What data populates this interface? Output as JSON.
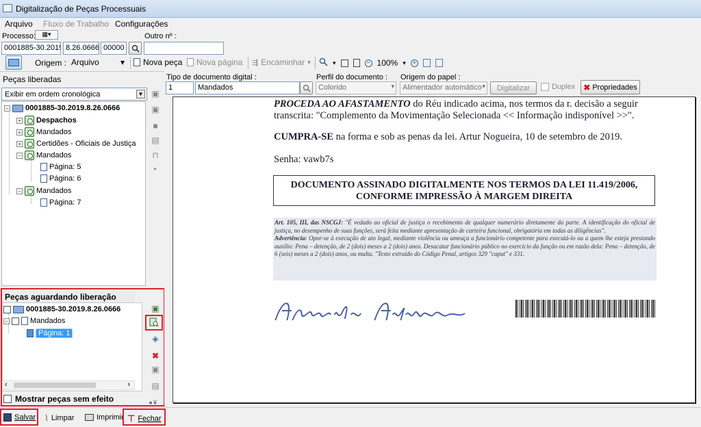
{
  "window": {
    "title": "Digitalização de Peças Processuais"
  },
  "menu": {
    "arquivo": "Arquivo",
    "fluxo": "Fluxo de Trabalho",
    "config": "Configurações"
  },
  "processo": {
    "label": "Processo:",
    "outro_label": "Outro nº :",
    "number_parts": [
      "0001885-30.2019",
      "8.26.0666",
      "00000"
    ],
    "outro_value": ""
  },
  "toolbar": {
    "origem_label": "Origem :",
    "origem_value": "Arquivo",
    "nova_peca": "Nova peça",
    "nova_pagina": "Nova página",
    "encaminhar": "Encaminhar",
    "zoom": "100%"
  },
  "doc_type": {
    "tipo_label": "Tipo de documento digital :",
    "tipo_code": "1",
    "tipo_value": "Mandados",
    "perfil_label": "Perfil do documento :",
    "perfil_value": "Colorido",
    "origem_papel_label": "Origem do papel :",
    "origem_papel_value": "Alimentador automático",
    "digitalizar": "Digitalizar",
    "duplex": "Duplex",
    "propriedades": "Propriedades"
  },
  "liberadas": {
    "title": "Peças liberadas",
    "filter": "Exibir em ordem cronológica",
    "root": "0001885-30.2019.8.26.0666",
    "items": [
      "Despachos",
      "Mandados",
      "Certidões - Oficiais de Justiça",
      "Mandados",
      "Página: 5",
      "Página: 6",
      "Mandados",
      "Página: 7"
    ]
  },
  "aguardando": {
    "title": "Peças aguardando liberação",
    "root": "0001885-30.2019.8.26.0666",
    "item": "Mandados",
    "page": "Página: 1",
    "mostrar": "Mostrar peças sem efeito"
  },
  "document": {
    "p1_bold": "PROCEDA AO AFASTAMENTO",
    "p1_rest": " do Réu indicado acima, nos termos da r. decisão a seguir",
    "p1_line2": "transcrita: \"Complemento da Movimentação Selecionada << Informação indisponível >>\".",
    "p2_bold": "CUMPRA-SE",
    "p2_rest": " na forma e sob as penas da lei. Artur Nogueira, 10 de setembro de 2019.",
    "senha": "Senha: vawb7s",
    "box_line1": "DOCUMENTO ASSINADO DIGITALMENTE NOS TERMOS DA LEI 11.419/2006,",
    "box_line2": "CONFORME IMPRESSÃO À MARGEM DIREITA",
    "note_art": "Art. 105, III, das NSCGJ:",
    "note_art_text": " \"É vedado ao oficial de justiça o recebimento de qualquer numerário diretamente da parte. A identificação do oficial de justiça, no desempenho de suas funções, será feita mediante apresentação de carteira funcional, obrigatória em todas as diligências\".",
    "note_adv": "Advertência:",
    "note_adv_text": " Opor-se à execução de ato legal, mediante violência ou ameaça a funcionário competente para executá-lo ou a quem lhe esteja prestando auxílio: Pena – detenção, de 2 (dois) meses a 2 (dois) anos. Desacatar funcionário público no exercício da função ou em razão dela: Pena – detenção, de 6 (seis) meses a 2 (dois) anos, ou multa. \"Texto extraído do Código Penal, artigos 329 \"caput\" e 331.",
    "signature": "Arnaldo Antunes"
  },
  "footer": {
    "salvar": "Salvar",
    "limpar": "Limpar",
    "imprimir": "Imprimir",
    "fechar": "Fechar"
  },
  "colors": {
    "highlight": "#e0202a",
    "selection": "#3399ff"
  }
}
